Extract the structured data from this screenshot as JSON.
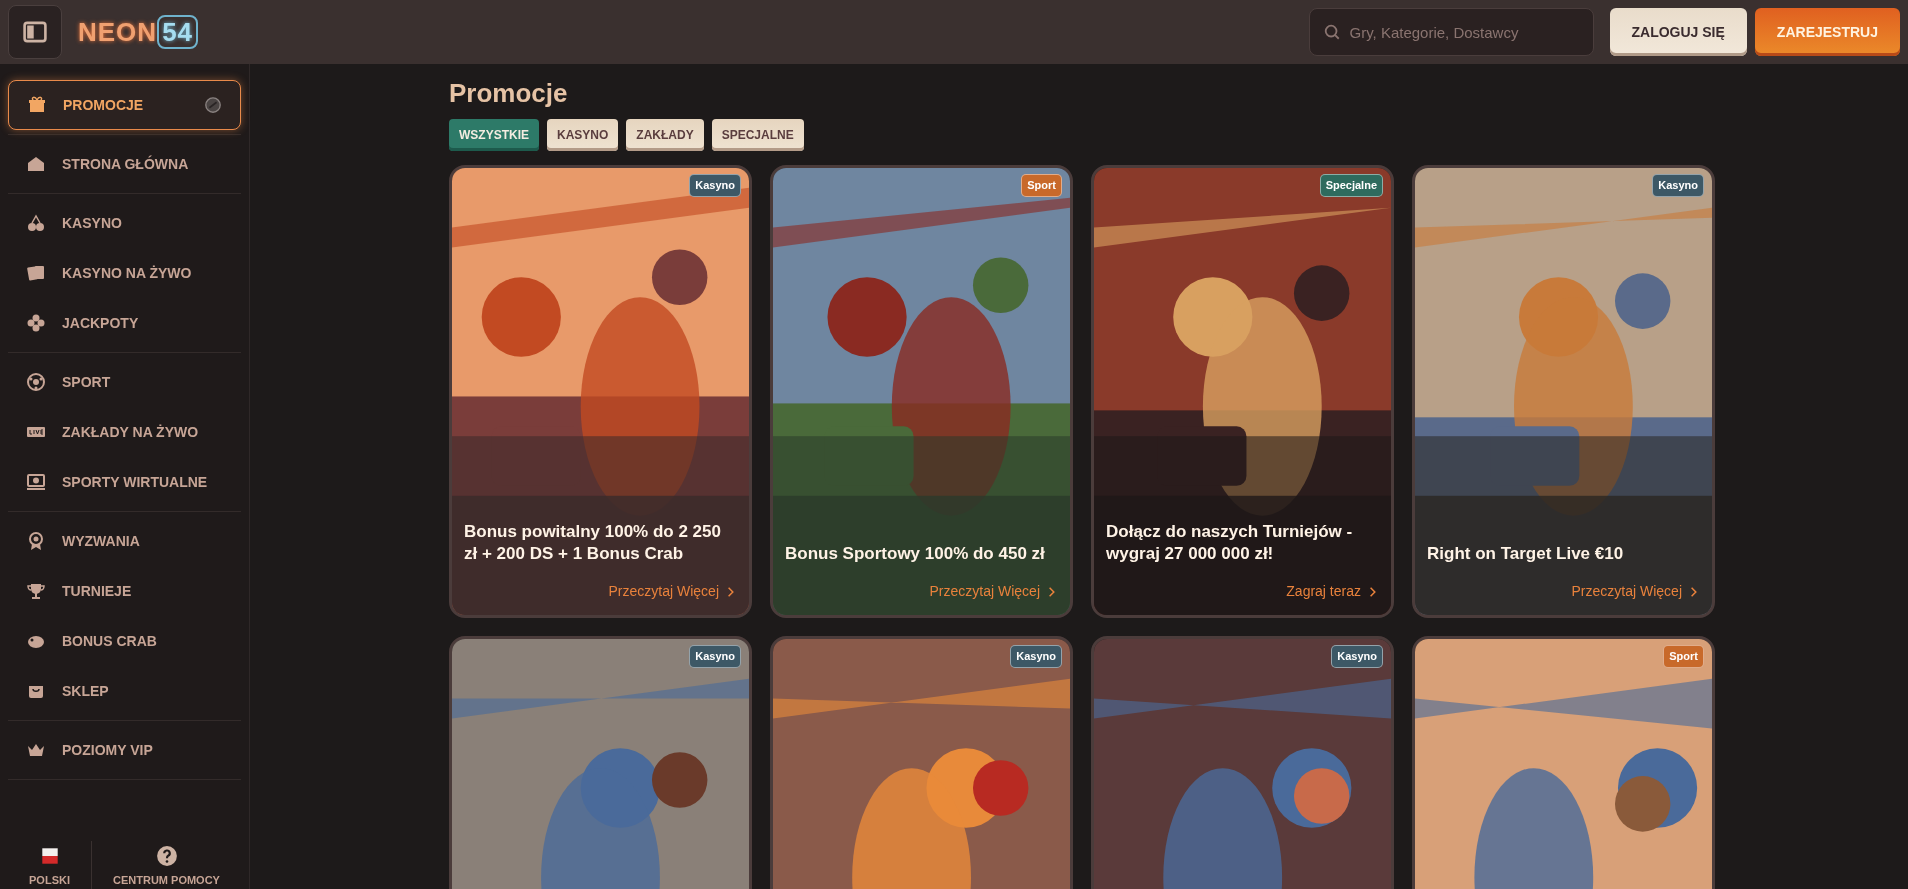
{
  "header": {
    "logo": {
      "text": "NEON",
      "accent": "54"
    },
    "search": {
      "placeholder": "Gry, Kategorie, Dostawcy"
    },
    "buttons": [
      {
        "label": "ZALOGUJ SIĘ",
        "kind": "secondary"
      },
      {
        "label": "ZAREJESTRUJ",
        "kind": "primary"
      }
    ]
  },
  "sidebar": {
    "groups": [
      {
        "items": [
          {
            "label": "PROMOCJE",
            "selected": true
          }
        ]
      },
      {
        "items": [
          {
            "label": "STRONA GŁÓWNA",
            "selected": false
          }
        ]
      },
      {
        "items": [
          {
            "label": "KASYNO",
            "selected": false
          },
          {
            "label": "KASYNO NA ŻYWO",
            "selected": false
          },
          {
            "label": "JACKPOTY",
            "selected": false
          }
        ]
      },
      {
        "items": [
          {
            "label": "SPORT",
            "selected": false
          },
          {
            "label": "ZAKŁADY NA ŻYWO",
            "selected": false
          },
          {
            "label": "SPORTY WIRTUALNE",
            "selected": false
          }
        ]
      },
      {
        "items": [
          {
            "label": "WYZWANIA",
            "selected": false
          },
          {
            "label": "TURNIEJE",
            "selected": false
          },
          {
            "label": "BONUS CRAB",
            "selected": false
          },
          {
            "label": "SKLEP",
            "selected": false
          }
        ]
      },
      {
        "items": [
          {
            "label": "POZIOMY VIP",
            "selected": false
          }
        ]
      }
    ],
    "footer": [
      {
        "label": "POLSKI"
      },
      {
        "label": "CENTRUM POMOCY"
      }
    ]
  },
  "main": {
    "title": "Promocje",
    "filters": [
      {
        "label": "WSZYSTKIE",
        "selected": true
      },
      {
        "label": "KASYNO",
        "selected": false
      },
      {
        "label": "ZAKŁADY",
        "selected": false
      },
      {
        "label": "SPECJALNE",
        "selected": false
      }
    ],
    "cards": [
      {
        "badge": {
          "label": "Kasyno",
          "color": "#3d5866"
        },
        "title": "Bonus powitalny 100% do 2 250 zł + 200 DS + 1 Bonus Crab",
        "link": "Przeczytaj Więcej"
      },
      {
        "badge": {
          "label": "Sport",
          "color": "#c8692a"
        },
        "title": "Bonus Sportowy 100% do 450 zł",
        "link": "Przeczytaj Więcej"
      },
      {
        "badge": {
          "label": "Specjalne",
          "color": "#2e6b5e"
        },
        "title": "Dołącz do naszych Turniejów - wygraj 27 000 000 zł!",
        "link": "Zagraj teraz"
      },
      {
        "badge": {
          "label": "Kasyno",
          "color": "#3d5866"
        },
        "title": "Right on Target Live €10",
        "link": "Przeczytaj Więcej"
      },
      {
        "badge": {
          "label": "Kasyno",
          "color": "#3d5866"
        }
      },
      {
        "badge": {
          "label": "Kasyno",
          "color": "#3d5866"
        }
      },
      {
        "badge": {
          "label": "Kasyno",
          "color": "#3d5866"
        }
      },
      {
        "badge": {
          "label": "Sport",
          "color": "#c8692a"
        }
      }
    ]
  }
}
